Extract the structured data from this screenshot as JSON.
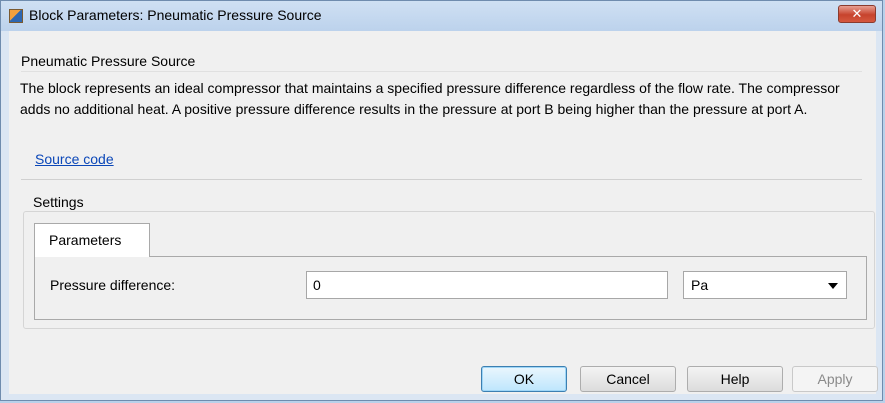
{
  "window": {
    "title": "Block Parameters: Pneumatic Pressure Source",
    "close_label": "✕"
  },
  "description": {
    "heading": "Pneumatic Pressure Source",
    "text": "The block represents an ideal compressor that maintains a specified pressure difference regardless of the flow rate. The compressor adds no additional heat. A positive pressure difference results in the pressure at port B being higher than the pressure at port A.",
    "link": "Source code"
  },
  "settings": {
    "heading": "Settings",
    "tab_label": "Parameters",
    "param_label": "Pressure difference:",
    "param_value": "0",
    "unit": "Pa"
  },
  "buttons": {
    "ok": "OK",
    "cancel": "Cancel",
    "help": "Help",
    "apply": "Apply"
  },
  "icons": {
    "app": "simulink-block-icon",
    "close": "close-icon",
    "dropdown": "chevron-down-icon"
  }
}
